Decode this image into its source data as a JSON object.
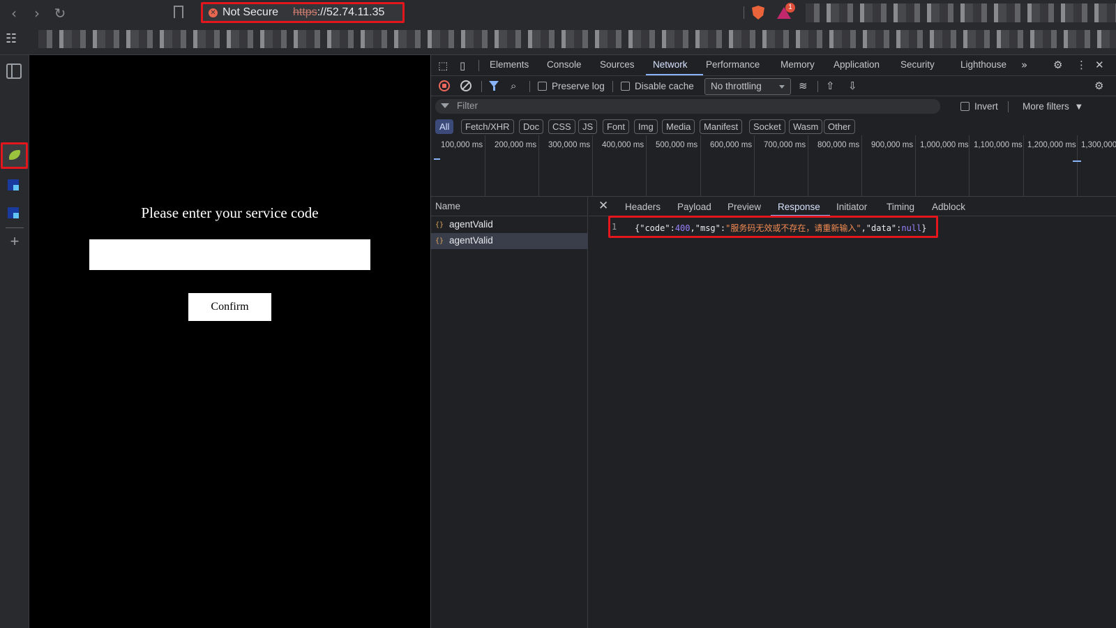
{
  "browser": {
    "security_label": "Not Secure",
    "url_scheme": "https",
    "url_rest": "://52.74.11.35",
    "rewards_count": "1",
    "accent": "#e3161e"
  },
  "page": {
    "heading": "Please enter your service code",
    "input_value": "",
    "confirm_label": "Confirm"
  },
  "devtools": {
    "tabs": [
      "Elements",
      "Console",
      "Sources",
      "Network",
      "Performance",
      "Memory",
      "Application",
      "Security",
      "Lighthouse"
    ],
    "active_tab": "Network",
    "toolbar": {
      "preserve_log": "Preserve log",
      "disable_cache": "Disable cache",
      "throttling": "No throttling"
    },
    "filter": {
      "placeholder": "Filter",
      "invert": "Invert",
      "more_filters": "More filters"
    },
    "types": [
      "All",
      "Fetch/XHR",
      "Doc",
      "CSS",
      "JS",
      "Font",
      "Img",
      "Media",
      "Manifest",
      "Socket",
      "Wasm",
      "Other"
    ],
    "timeline_ticks": [
      "100,000 ms",
      "200,000 ms",
      "300,000 ms",
      "400,000 ms",
      "500,000 ms",
      "600,000 ms",
      "700,000 ms",
      "800,000 ms",
      "900,000 ms",
      "1,000,000 ms",
      "1,100,000 ms",
      "1,200,000 ms",
      "1,300,000"
    ],
    "requests_header": "Name",
    "requests": [
      "agentValid",
      "agentValid"
    ],
    "detail_tabs": [
      "Headers",
      "Payload",
      "Preview",
      "Response",
      "Initiator",
      "Timing",
      "Adblock"
    ],
    "active_detail_tab": "Response",
    "response": {
      "line_number": "1",
      "open_brace": "{",
      "k_code": "\"code\"",
      "v_code": "400",
      "k_msg": "\"msg\"",
      "v_msg": "\"服务码无效或不存在，请重新输入\"",
      "k_data": "\"data\"",
      "v_data": "null",
      "close_brace": "}"
    }
  }
}
